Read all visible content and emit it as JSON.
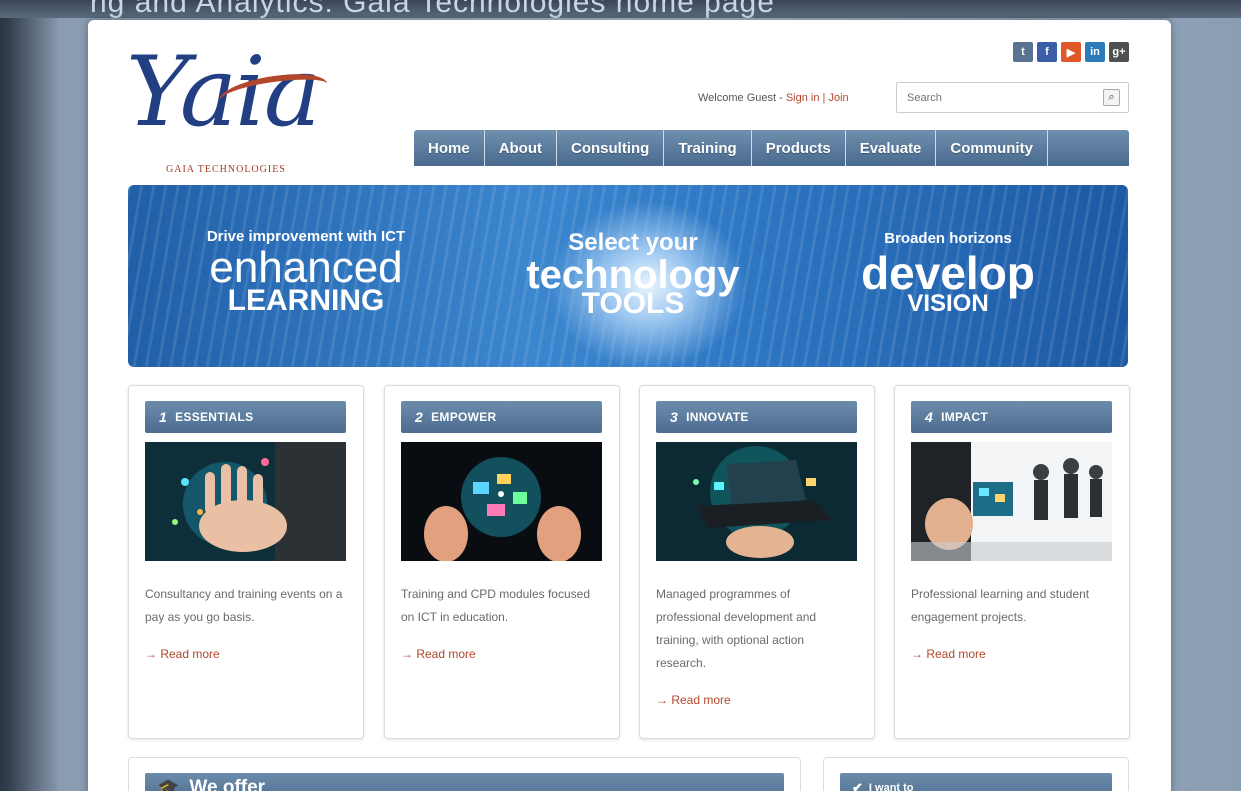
{
  "top_strip_text": "ng and Analytics: Gaia Technologies home page",
  "logo": {
    "wordmark": "Yaia",
    "tagline": "GAIA TECHNOLOGIES"
  },
  "social": [
    {
      "icon": "tumblr-icon",
      "glyph": "t",
      "color": "#5a7390"
    },
    {
      "icon": "facebook-icon",
      "glyph": "f",
      "color": "#3b5ea8"
    },
    {
      "icon": "youtube-icon",
      "glyph": "▶",
      "color": "#e0572a"
    },
    {
      "icon": "linkedin-icon",
      "glyph": "in",
      "color": "#2a7bb8"
    },
    {
      "icon": "googleplus-icon",
      "glyph": "g+",
      "color": "#4f4f4f"
    }
  ],
  "header": {
    "welcome": "Welcome Guest - ",
    "signin": "Sign in",
    "sep": " | ",
    "join": "Join",
    "search_placeholder": "Search"
  },
  "nav": [
    "Home",
    "About",
    "Consulting",
    "Training",
    "Products",
    "Evaluate",
    "Community"
  ],
  "banner": {
    "b1_small": "Drive improvement with ICT",
    "b1_big": "enhanced",
    "b1_caps": "LEARNING",
    "b2_small": "Select your",
    "b2_big": "technology",
    "b2_caps": "TOOLS",
    "b3_small": "Broaden horizons",
    "b3_big": "develop",
    "b3_caps": "VISION"
  },
  "cards": [
    {
      "num": "1",
      "title": "ESSENTIALS",
      "desc": "Consultancy and training events on a pay as you go basis.",
      "more": "→ Read more"
    },
    {
      "num": "2",
      "title": "EMPOWER",
      "desc": "Training and CPD modules focused on ICT in education.",
      "more": "→ Read more"
    },
    {
      "num": "3",
      "title": "INNOVATE",
      "desc": "Managed programmes of professional development and training, with optional action research.",
      "more": "→ Read more"
    },
    {
      "num": "4",
      "title": "IMPACT",
      "desc": "Professional learning and student engagement projects.",
      "more": "→ Read more"
    }
  ],
  "bottom": {
    "we_offer": "We offer",
    "i_want_to": "I want to"
  }
}
